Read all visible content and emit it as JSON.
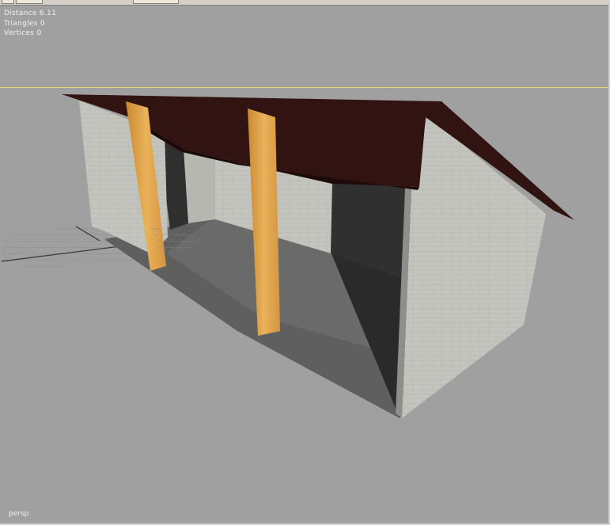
{
  "hud": {
    "distance": "Distance 6.11",
    "triangles": "Triangles 0",
    "vertices": "Vertices 0"
  },
  "viewport": {
    "label": "persp",
    "background": "#a0a0a0",
    "horizon_color": "#e6d86a"
  },
  "scene": {
    "roof_color": "#311311",
    "wall_color": "#c6c6c0",
    "beam_color": "#e3a54a",
    "floor_color": "#616161"
  }
}
